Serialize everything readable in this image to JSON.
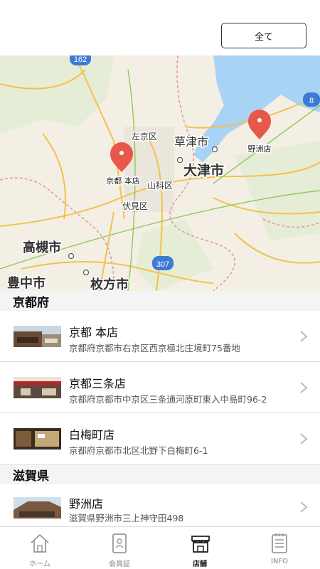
{
  "header": {
    "all_button_label": "全て"
  },
  "map": {
    "places": {
      "sakyo": "左京区",
      "kusatsu": "草津市",
      "otsu": "大津市",
      "yamashina": "山科区",
      "fushimi": "伏見区",
      "takatsuki": "高槻市",
      "toyonaka": "豊中市",
      "hirakata": "枚方市"
    },
    "pins": {
      "kyoto_honten": "京都 本店",
      "yasu": "野洲店"
    },
    "road_shields": {
      "r162": "162",
      "r307": "307",
      "r8": "8"
    }
  },
  "regions": [
    {
      "name": "京都府",
      "stores": [
        {
          "name": "京都 本店",
          "address": "京都府京都市右京区西京極北庄境町75番地"
        },
        {
          "name": " 京都三条店",
          "address": "京都府京都市中京区三条通河原町東入中島町96-2"
        },
        {
          "name": "白梅町店",
          "address": "京都府京都市北区北野下白梅町6-1"
        }
      ]
    },
    {
      "name": "滋賀県",
      "stores": [
        {
          "name": "野洲店",
          "address": "滋賀県野洲市三上神守田498"
        }
      ]
    }
  ],
  "tabbar": {
    "home": "ホーム",
    "member": "会員証",
    "stores": "店舗",
    "info": "INFO"
  },
  "colors": {
    "pin": "#e8584a",
    "lake": "#a9d3f5",
    "active_tab": "#222222",
    "inactive_tab": "#888888"
  }
}
